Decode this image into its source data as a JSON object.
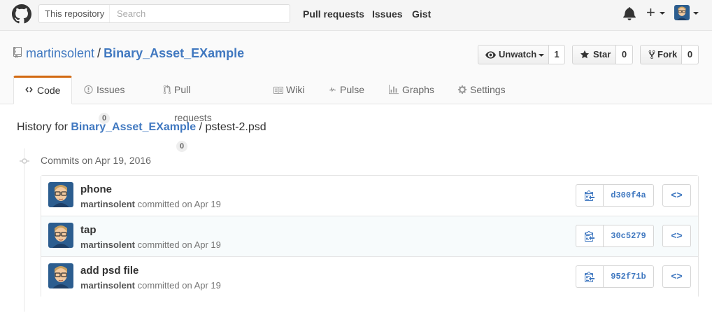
{
  "header": {
    "search_scope": "This repository",
    "search_placeholder": "Search",
    "nav": [
      "Pull requests",
      "Issues",
      "Gist"
    ],
    "plus_symbol": "+"
  },
  "repo": {
    "owner": "martinsolent",
    "separator": "/",
    "name": "Binary_Asset_EXample",
    "watch_label": "Unwatch",
    "watch_count": "1",
    "star_label": "Star",
    "star_count": "0",
    "fork_label": "Fork",
    "fork_count": "0",
    "tabs": [
      {
        "label": "Code",
        "count": null
      },
      {
        "label": "Issues",
        "count": "0"
      },
      {
        "label": "Pull requests",
        "count": "0"
      },
      {
        "label": "Wiki",
        "count": null
      },
      {
        "label": "Pulse",
        "count": null
      },
      {
        "label": "Graphs",
        "count": null
      },
      {
        "label": "Settings",
        "count": null
      }
    ]
  },
  "history": {
    "prefix": "History for",
    "repo_link": "Binary_Asset_EXample",
    "separator": "/",
    "file": "pstest-2.psd",
    "commits_heading": "Commits on Apr 19, 2016",
    "commits": [
      {
        "title": "phone",
        "author": "martinsolent",
        "meta": "committed on Apr 19",
        "sha": "d300f4a"
      },
      {
        "title": "tap",
        "author": "martinsolent",
        "meta": "committed on Apr 19",
        "sha": "30c5279"
      },
      {
        "title": "add psd file",
        "author": "martinsolent",
        "meta": "committed on Apr 19",
        "sha": "952f71b"
      }
    ],
    "browse_symbol": "<>"
  },
  "colors": {
    "link": "#4078c0",
    "tab_accent": "#d26911",
    "header_bg": "#f5f5f5"
  },
  "icons": [
    "github-logo-icon",
    "bell-icon",
    "plus-icon",
    "repo-icon",
    "eye-icon",
    "star-icon",
    "fork-icon",
    "code-icon",
    "issue-icon",
    "pull-request-icon",
    "book-icon",
    "pulse-icon",
    "graph-icon",
    "gear-icon",
    "commit-dot-icon",
    "clipboard-icon"
  ]
}
